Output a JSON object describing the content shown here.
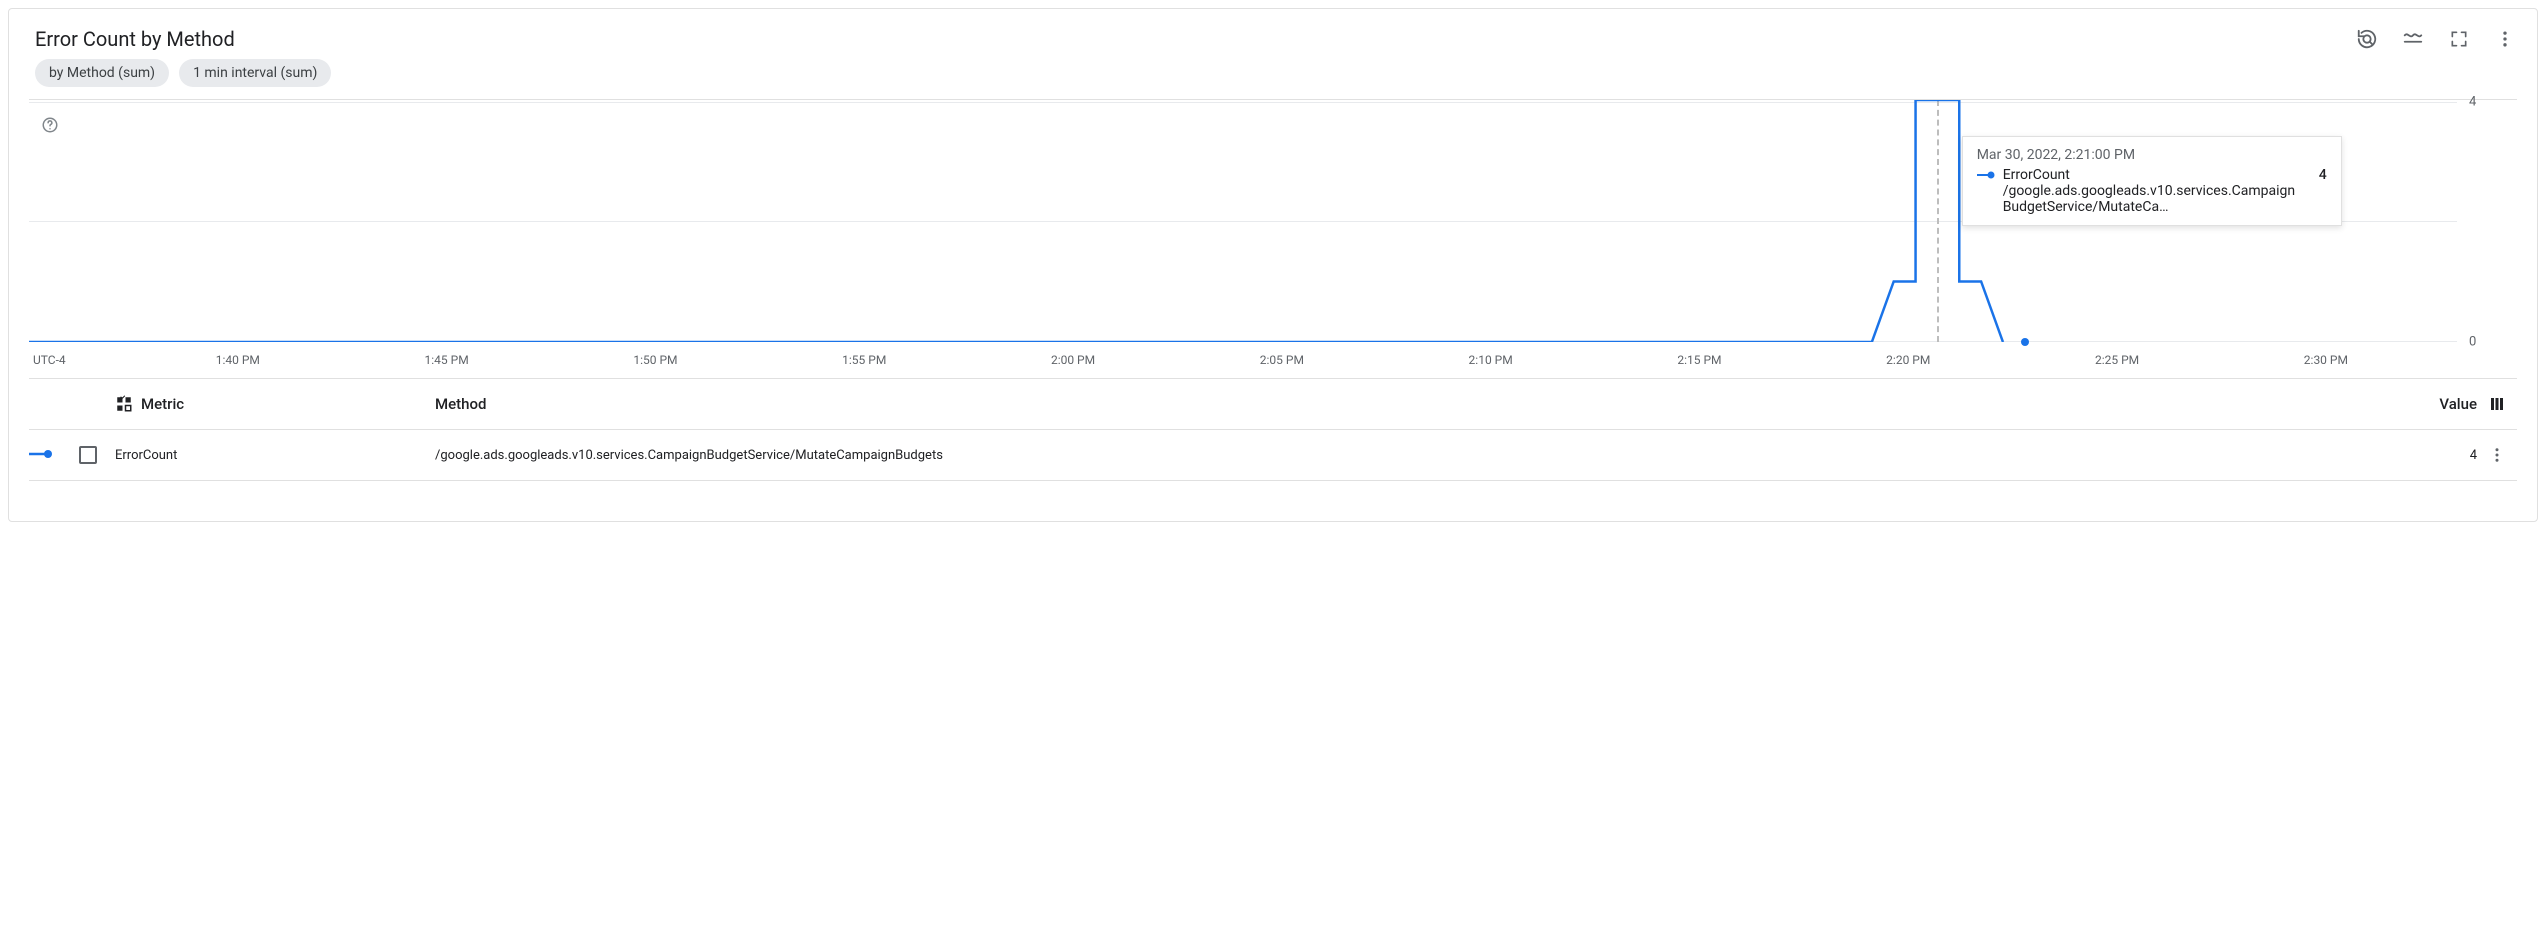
{
  "title": "Error Count by Method",
  "chips": [
    "by Method (sum)",
    "1 min interval (sum)"
  ],
  "timezone": "UTC-4",
  "x_ticks": [
    "1:40 PM",
    "1:45 PM",
    "1:50 PM",
    "1:55 PM",
    "2:00 PM",
    "2:05 PM",
    "2:10 PM",
    "2:15 PM",
    "2:20 PM",
    "2:25 PM",
    "2:30 PM"
  ],
  "y_ticks": {
    "top": "4",
    "bottom": "0"
  },
  "tooltip": {
    "time": "Mar 30, 2022, 2:21:00 PM",
    "label": "ErrorCount /google.ads.googleads.v10.services.CampaignBudgetService/MutateCa…",
    "value": "4"
  },
  "table": {
    "headers": {
      "metric": "Metric",
      "method": "Method",
      "value": "Value"
    },
    "row": {
      "metric": "ErrorCount",
      "method": "/google.ads.googleads.v10.services.CampaignBudgetService/MutateCampaignBudgets",
      "value": "4"
    }
  },
  "chart_data": {
    "type": "line",
    "title": "Error Count by Method",
    "xlabel": "",
    "ylabel": "",
    "ylim": [
      0,
      4
    ],
    "x_range": [
      "1:35 PM",
      "2:33 PM"
    ],
    "series": [
      {
        "name": "ErrorCount /google.ads.googleads.v10.services.CampaignBudgetService/MutateCampaignBudgets",
        "points": [
          {
            "x": "2:19 PM",
            "y": 0
          },
          {
            "x": "2:20 PM",
            "y": 1
          },
          {
            "x": "2:21 PM",
            "y": 4
          },
          {
            "x": "2:22 PM",
            "y": 1
          },
          {
            "x": "2:23 PM",
            "y": 0
          }
        ]
      }
    ],
    "crosshair_x": "2:21 PM"
  }
}
